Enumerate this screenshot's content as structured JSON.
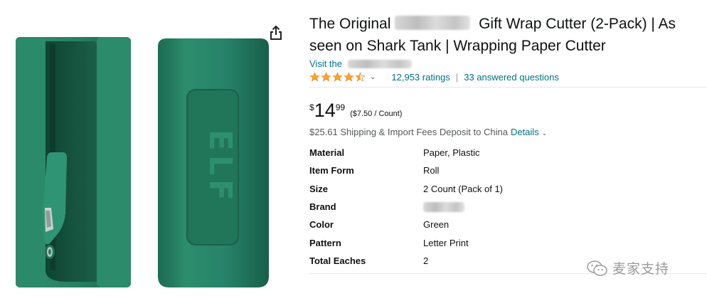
{
  "product": {
    "title_part1": "The Original",
    "title_part2": "Gift Wrap Cutter (2-Pack) | As seen on Shark Tank | Wrapping Paper Cutter",
    "store_prefix": "Visit the",
    "rating_stars": 4.5,
    "ratings_text": "12,953 ratings",
    "separator": "|",
    "answered_text": "33 answered questions",
    "price_symbol": "$",
    "price_whole": "14",
    "price_fraction": "99",
    "unit_price": "($7.50 / Count)",
    "shipping_text": "$25.61 Shipping & Import Fees Deposit to China",
    "details_label": "Details",
    "logo_text": "ELF"
  },
  "specs": [
    {
      "key": "Material",
      "value": "Paper, Plastic"
    },
    {
      "key": "Item Form",
      "value": "Roll"
    },
    {
      "key": "Size",
      "value": "2 Count (Pack of 1)"
    },
    {
      "key": "Brand",
      "value": ""
    },
    {
      "key": "Color",
      "value": "Green"
    },
    {
      "key": "Pattern",
      "value": "Letter Print"
    },
    {
      "key": "Total Eaches",
      "value": "2"
    }
  ],
  "watermark": {
    "text": "麦家支持"
  },
  "colors": {
    "link": "#007185",
    "star": "#ffa41c",
    "product_green": "#1f7a5c"
  }
}
